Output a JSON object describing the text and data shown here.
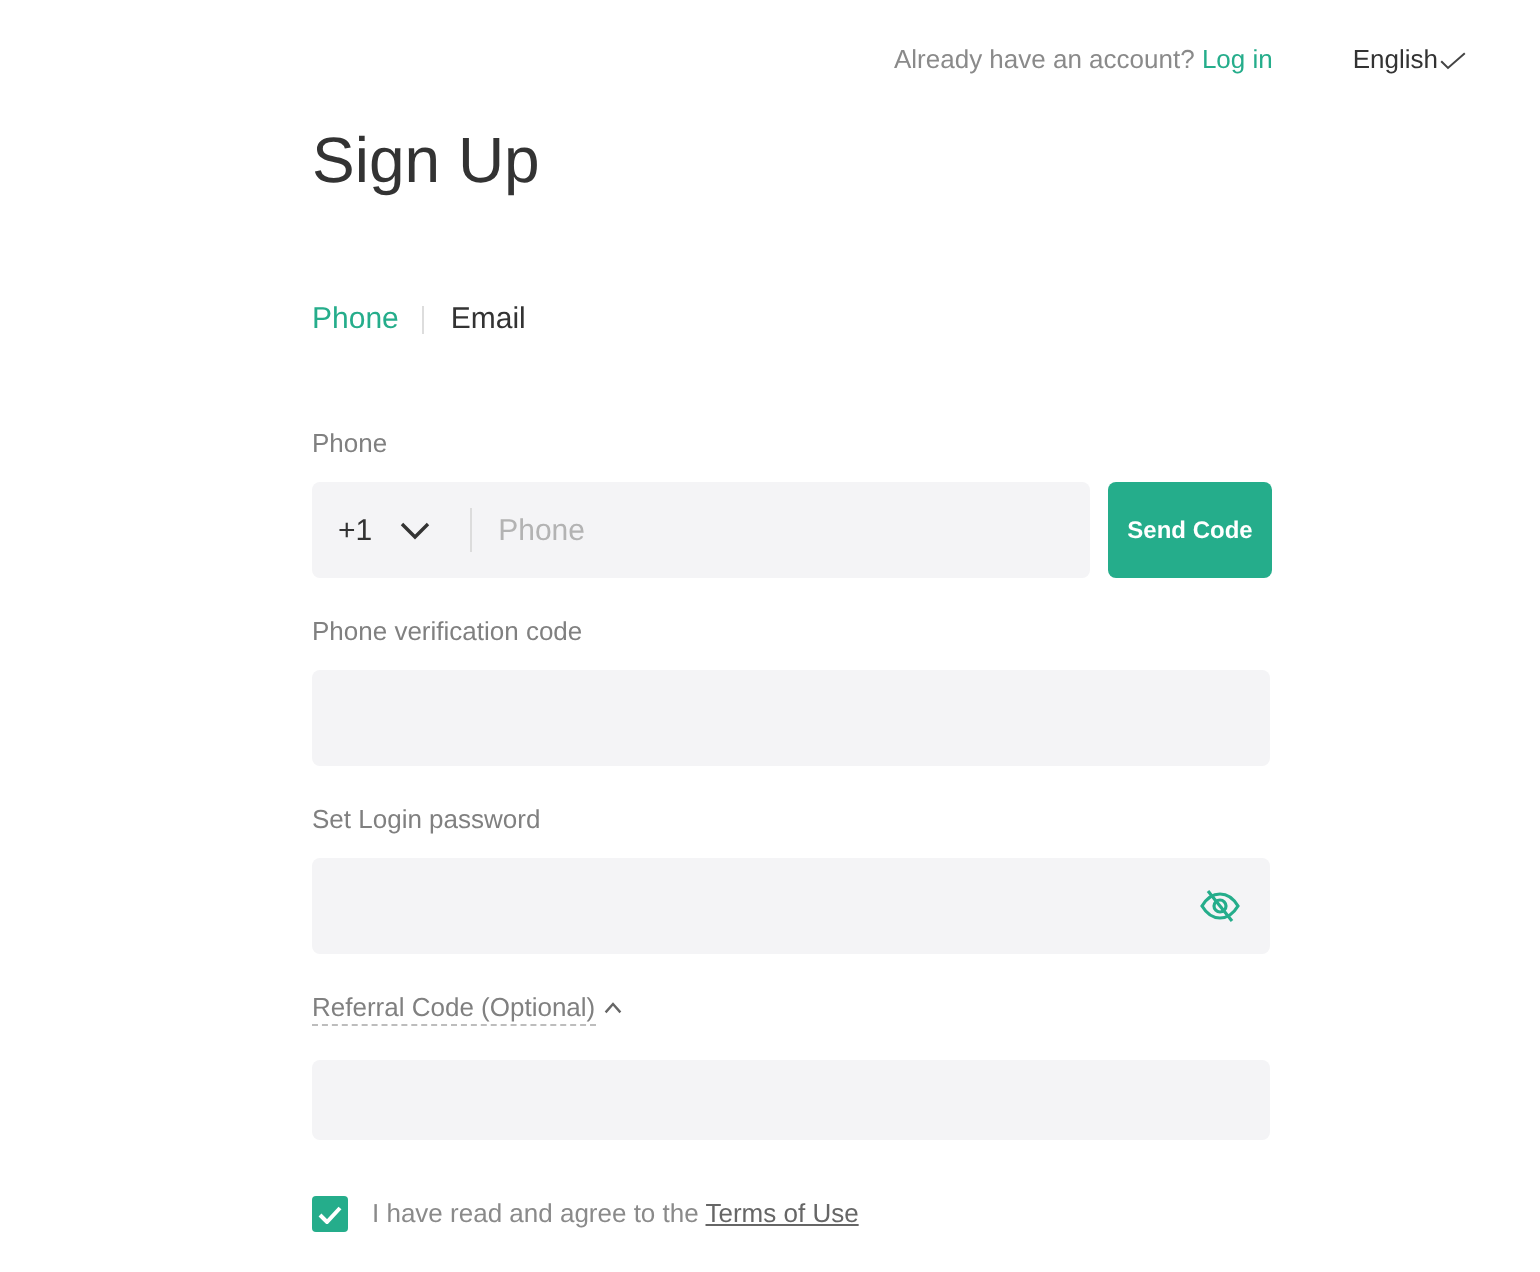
{
  "header": {
    "prompt": "Already have an account?",
    "login_link": "Log in",
    "language": "English"
  },
  "title": "Sign Up",
  "tabs": [
    {
      "label": "Phone",
      "selected": true
    },
    {
      "label": "Email",
      "selected": false
    }
  ],
  "fields": [
    {
      "kind": "phone",
      "label": "Phone",
      "country_code": "+1",
      "placeholder": "Phone",
      "button": "Send Code"
    },
    {
      "kind": "text",
      "label": "Phone verification code"
    },
    {
      "kind": "password",
      "label": "Set Login password"
    },
    {
      "kind": "referral",
      "label": "Referral Code (Optional)",
      "expanded": true
    }
  ],
  "agreement": {
    "checked": true,
    "text": "I have read and agree to the",
    "link": "Terms of Use"
  }
}
